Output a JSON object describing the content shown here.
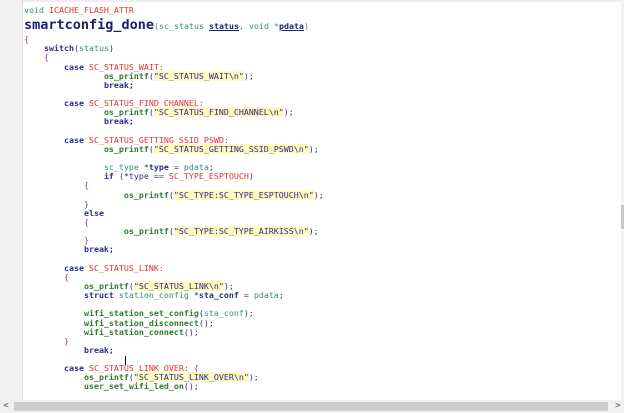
{
  "header": {
    "void": "void ",
    "attr": "ICACHE_FLASH_ATTR",
    "func": "smartconfig_done",
    "p1": "(sc_status ",
    "p2": "status",
    ",": ", void *",
    "p3": "pdata",
    ")": ")"
  },
  "lines": [
    [
      [
        "{",
        "br"
      ]
    ],
    [
      [
        "    ",
        ""
      ],
      [
        "switch",
        "kw"
      ],
      [
        "(",
        "pl"
      ],
      [
        "status",
        "ty"
      ],
      [
        ")",
        "pl"
      ]
    ],
    [
      [
        "    {",
        "br"
      ]
    ],
    [
      [
        "        ",
        ""
      ],
      [
        "case ",
        "kw"
      ],
      [
        "SC_STATUS_WAIT:",
        "mac"
      ]
    ],
    [
      [
        "                ",
        ""
      ],
      [
        "os_printf",
        "fn"
      ],
      [
        "(",
        "pl"
      ],
      [
        "\"SC_STATUS_WAIT\\n\"",
        "str"
      ],
      [
        ");",
        "pl"
      ]
    ],
    [
      [
        "                ",
        ""
      ],
      [
        "break;",
        "kw"
      ]
    ],
    [
      [
        "",
        ""
      ]
    ],
    [
      [
        "        ",
        ""
      ],
      [
        "case ",
        "kw"
      ],
      [
        "SC_STATUS_FIND_CHANNEL:",
        "mac"
      ]
    ],
    [
      [
        "                ",
        ""
      ],
      [
        "os_printf",
        "fn"
      ],
      [
        "(",
        "pl"
      ],
      [
        "\"SC_STATUS_FIND_CHANNEL\\n\"",
        "str"
      ],
      [
        ");",
        "pl"
      ]
    ],
    [
      [
        "                ",
        ""
      ],
      [
        "break;",
        "kw"
      ]
    ],
    [
      [
        "",
        ""
      ]
    ],
    [
      [
        "        ",
        ""
      ],
      [
        "case ",
        "kw"
      ],
      [
        "SC_STATUS_GETTING_SSID_PSWD:",
        "mac"
      ]
    ],
    [
      [
        "                ",
        ""
      ],
      [
        "os_printf",
        "fn"
      ],
      [
        "(",
        "pl"
      ],
      [
        "\"SC_STATUS_GETTING_SSID_PSWD\\n\"",
        "str"
      ],
      [
        ");",
        "pl"
      ]
    ],
    [
      [
        "",
        ""
      ]
    ],
    [
      [
        "                ",
        ""
      ],
      [
        "sc_type ",
        "ty"
      ],
      [
        "*",
        "pl"
      ],
      [
        "type",
        "id"
      ],
      [
        " = ",
        "pl"
      ],
      [
        "pdata",
        "ty"
      ],
      [
        ";",
        "pl"
      ]
    ],
    [
      [
        "                ",
        ""
      ],
      [
        "if ",
        "kw"
      ],
      [
        "(*type == ",
        "pl"
      ],
      [
        "SC_TYPE_ESPTOUCH",
        "mac"
      ],
      [
        ")",
        "pl"
      ]
    ],
    [
      [
        "            {",
        "br"
      ]
    ],
    [
      [
        "                    ",
        ""
      ],
      [
        "os_printf",
        "fn"
      ],
      [
        "(",
        "pl"
      ],
      [
        "\"SC_TYPE:SC_TYPE_ESPTOUCH\\n\"",
        "str"
      ],
      [
        ");",
        "pl"
      ]
    ],
    [
      [
        "            }",
        "br"
      ]
    ],
    [
      [
        "            ",
        ""
      ],
      [
        "else",
        "kw"
      ]
    ],
    [
      [
        "            {",
        "br"
      ]
    ],
    [
      [
        "                    ",
        ""
      ],
      [
        "os_printf",
        "fn"
      ],
      [
        "(",
        "pl"
      ],
      [
        "\"SC_TYPE:SC_TYPE_AIRKISS\\n\"",
        "str"
      ],
      [
        ");",
        "pl"
      ]
    ],
    [
      [
        "            }",
        "br"
      ]
    ],
    [
      [
        "            ",
        ""
      ],
      [
        "break;",
        "kw"
      ]
    ],
    [
      [
        "",
        ""
      ]
    ],
    [
      [
        "        ",
        ""
      ],
      [
        "case ",
        "kw"
      ],
      [
        "SC_STATUS_LINK:",
        "mac"
      ]
    ],
    [
      [
        "        {",
        "br"
      ]
    ],
    [
      [
        "            ",
        ""
      ],
      [
        "os_printf",
        "fn"
      ],
      [
        "(",
        "pl"
      ],
      [
        "\"SC_STATUS_LINK\\n\"",
        "str"
      ],
      [
        ");",
        "pl"
      ]
    ],
    [
      [
        "            ",
        ""
      ],
      [
        "struct ",
        "kw"
      ],
      [
        "station_config ",
        "ty"
      ],
      [
        "*",
        "pl"
      ],
      [
        "sta_conf",
        "id"
      ],
      [
        " = ",
        "pl"
      ],
      [
        "pdata",
        "ty"
      ],
      [
        ";",
        "pl"
      ]
    ],
    [
      [
        "",
        ""
      ]
    ],
    [
      [
        "            ",
        ""
      ],
      [
        "wifi_station_set_config",
        "fn"
      ],
      [
        "(",
        "pl"
      ],
      [
        "sta_conf",
        "ty"
      ],
      [
        ");",
        "pl"
      ]
    ],
    [
      [
        "            ",
        ""
      ],
      [
        "wifi_station_disconnect",
        "fn"
      ],
      [
        "();",
        "pl"
      ]
    ],
    [
      [
        "            ",
        ""
      ],
      [
        "wifi_station_connect",
        "fn"
      ],
      [
        "();",
        "pl"
      ]
    ],
    [
      [
        "        }",
        "br"
      ]
    ],
    [
      [
        "            ",
        ""
      ],
      [
        "break;",
        "kw"
      ]
    ],
    [
      [
        "",
        ""
      ]
    ],
    [
      [
        "        ",
        ""
      ],
      [
        "case ",
        "kw"
      ],
      [
        "SC_STATUS_LINK_OVER: ",
        "mac"
      ],
      [
        "{",
        "br"
      ]
    ],
    [
      [
        "            ",
        ""
      ],
      [
        "os_printf",
        "fn"
      ],
      [
        "(",
        "pl"
      ],
      [
        "\"SC_STATUS_LINK_OVER\\n\"",
        "str"
      ],
      [
        ");",
        "pl"
      ]
    ],
    [
      [
        "            ",
        ""
      ],
      [
        "user_set_wifi_led_on",
        "fn"
      ],
      [
        "();",
        "pl"
      ]
    ]
  ],
  "scroll": {
    "left_arrow": "<",
    "right_arrow": ">"
  }
}
